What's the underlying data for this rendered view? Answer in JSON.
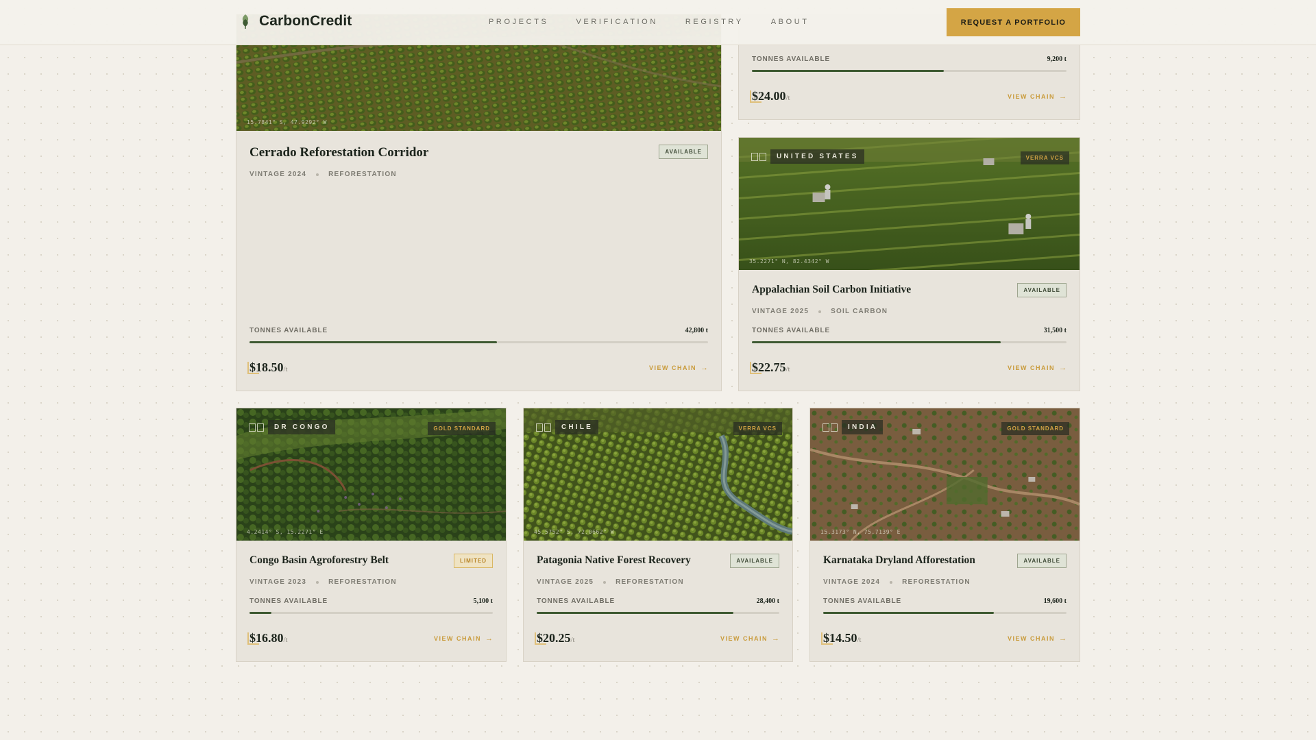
{
  "header": {
    "brand": "CarbonCredit",
    "nav": [
      "PROJECTS",
      "VERIFICATION",
      "REGISTRY",
      "ABOUT"
    ],
    "cta": "REQUEST A PORTFOLIO"
  },
  "colors": {
    "accent": "#d4a545",
    "bar": "#3e5a32",
    "background": "#f3f0ea",
    "card": "#e8e4dc"
  },
  "cards": {
    "top_right": {
      "tonnes_label": "TONNES AVAILABLE",
      "tonnes": "9,200 t",
      "fill": 0.61,
      "price": "$24.00",
      "unit": "/t",
      "view_chain": "VIEW CHAIN"
    },
    "cerrado": {
      "coords": "15.7841° S, 47.9292° W",
      "title": "Cerrado Reforestation Corridor",
      "status": "AVAILABLE",
      "vintage": "VINTAGE 2024",
      "category": "REFORESTATION",
      "tonnes_label": "TONNES AVAILABLE",
      "tonnes": "42,800 t",
      "fill": 0.54,
      "price": "$18.50",
      "unit": "/t",
      "view_chain": "VIEW CHAIN"
    },
    "appalachian": {
      "country": "UNITED STATES",
      "standard": "VERRA VCS",
      "coords": "35.2271° N, 82.4342° W",
      "title": "Appalachian Soil Carbon Initiative",
      "status": "AVAILABLE",
      "vintage": "VINTAGE 2025",
      "category": "SOIL CARBON",
      "tonnes_label": "TONNES AVAILABLE",
      "tonnes": "31,500 t",
      "fill": 0.79,
      "price": "$22.75",
      "unit": "/t",
      "view_chain": "VIEW CHAIN"
    },
    "congo": {
      "country": "DR CONGO",
      "standard": "GOLD STANDARD",
      "coords": "4.2414° S, 15.2271° E",
      "title": "Congo Basin Agroforestry Belt",
      "status": "LIMITED",
      "vintage": "VINTAGE 2023",
      "category": "REFORESTATION",
      "tonnes_label": "TONNES AVAILABLE",
      "tonnes": "5,100 t",
      "fill": 0.09,
      "price": "$16.80",
      "unit": "/t",
      "view_chain": "VIEW CHAIN"
    },
    "patagonia": {
      "country": "CHILE",
      "standard": "VERRA VCS",
      "coords": "45.5752° S, 72.0662° W",
      "title": "Patagonia Native Forest Recovery",
      "status": "AVAILABLE",
      "vintage": "VINTAGE 2025",
      "category": "REFORESTATION",
      "tonnes_label": "TONNES AVAILABLE",
      "tonnes": "28,400 t",
      "fill": 0.81,
      "price": "$20.25",
      "unit": "/t",
      "view_chain": "VIEW CHAIN"
    },
    "karnataka": {
      "country": "INDIA",
      "standard": "GOLD STANDARD",
      "coords": "15.3173° N, 75.7139° E",
      "title": "Karnataka Dryland Afforestation",
      "status": "AVAILABLE",
      "vintage": "VINTAGE 2024",
      "category": "REFORESTATION",
      "tonnes_label": "TONNES AVAILABLE",
      "tonnes": "19,600 t",
      "fill": 0.7,
      "price": "$14.50",
      "unit": "/t",
      "view_chain": "VIEW CHAIN"
    }
  }
}
